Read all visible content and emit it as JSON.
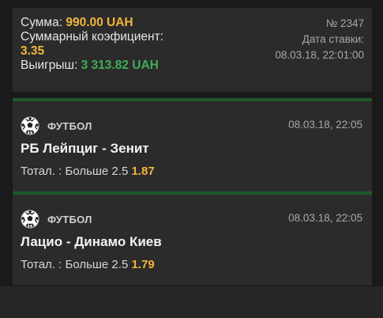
{
  "summary": {
    "sum_label": "Сумма:",
    "sum_value": "990.00 UAH",
    "coef_label": "Суммарный коэфициент:",
    "coef_value": "3.35",
    "win_label": "Выигрыш:",
    "win_value": "3 313.82 UAH",
    "ticket_number": "№ 2347",
    "bet_date_label": "Дата ставки:",
    "bet_date_value": "08.03.18, 22:01:00"
  },
  "bets": [
    {
      "sport": "ФУТБОЛ",
      "icon": "soccer-ball-icon",
      "date": "08.03.18, 22:05",
      "match": "РБ Лейпциг - Зенит",
      "market": "Тотал. : Больше 2.5",
      "odds": "1.87"
    },
    {
      "sport": "ФУТБОЛ",
      "icon": "soccer-ball-icon",
      "date": "08.03.18, 22:05",
      "match": "Лацио - Динамо Киев",
      "market": "Тотал. : Больше 2.5",
      "odds": "1.79"
    }
  ],
  "colors": {
    "background": "#1a1a1a",
    "card": "#2b2b2b",
    "accent_yellow": "#f2b53a",
    "accent_green": "#3fae55",
    "divider_green": "#1f5a2a"
  }
}
